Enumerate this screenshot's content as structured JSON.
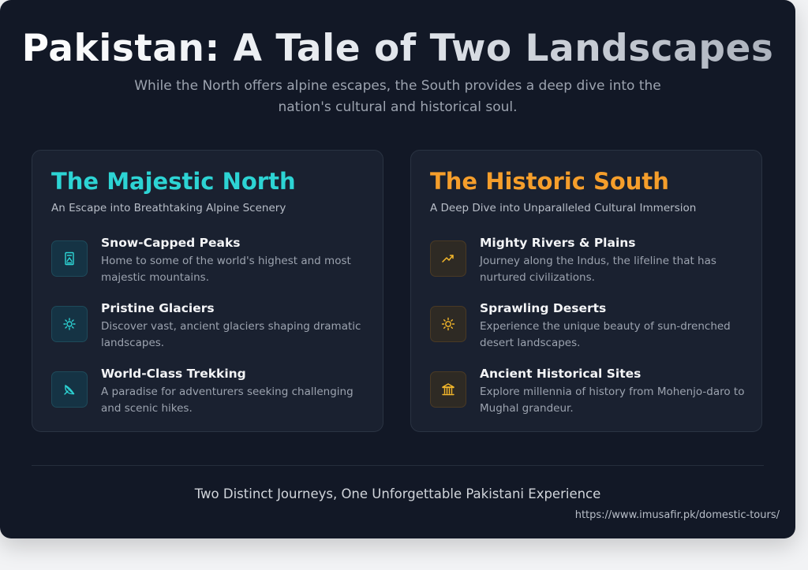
{
  "header": {
    "title": "Pakistan: A Tale of Two Landscapes",
    "subtitle": "While the North offers alpine escapes, the South provides a deep dive into the nation's cultural and historical soul."
  },
  "north": {
    "title": "The Majestic North",
    "subtitle": "An Escape into Breathtaking Alpine Scenery",
    "accent": "#2dd4d4",
    "features": [
      {
        "icon": "mountain-icon",
        "title": "Snow-Capped Peaks",
        "description": "Home to some of the world's highest and most majestic mountains."
      },
      {
        "icon": "snowflake-icon",
        "title": "Pristine Glaciers",
        "description": "Discover vast, ancient glaciers shaping dramatic landscapes."
      },
      {
        "icon": "leaf-icon",
        "title": "World-Class Trekking",
        "description": "A paradise for adventurers seeking challenging and scenic hikes."
      }
    ]
  },
  "south": {
    "title": "The Historic South",
    "subtitle": "A Deep Dive into Unparalleled Cultural Immersion",
    "accent": "#f59e2b",
    "features": [
      {
        "icon": "trending-up-icon",
        "title": "Mighty Rivers & Plains",
        "description": "Journey along the Indus, the lifeline that has nurtured civilizations."
      },
      {
        "icon": "sun-icon",
        "title": "Sprawling Deserts",
        "description": "Experience the unique beauty of sun-drenched desert landscapes."
      },
      {
        "icon": "landmark-icon",
        "title": "Ancient Historical Sites",
        "description": "Explore millennia of history from Mohenjo-daro to Mughal grandeur."
      }
    ]
  },
  "footer": {
    "tagline": "Two Distinct Journeys, One Unforgettable Pakistani Experience",
    "url": "https://www.imusafir.pk/domestic-tours/"
  }
}
